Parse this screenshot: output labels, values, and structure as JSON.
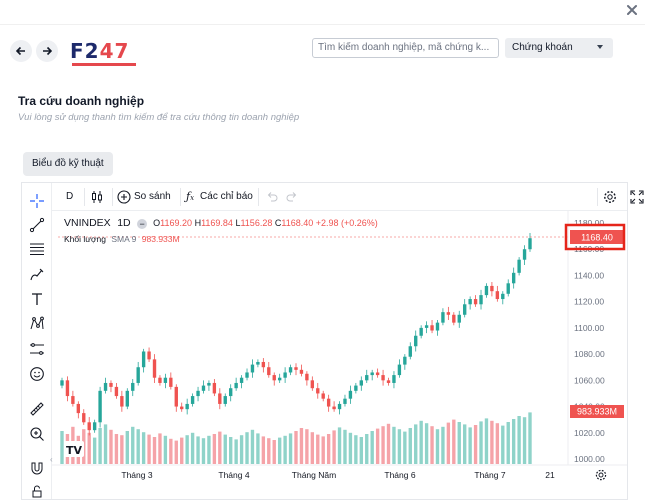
{
  "window": {
    "close_icon": "close-icon"
  },
  "header": {
    "back_icon": "arrow-left-icon",
    "forward_icon": "arrow-right-icon",
    "logo_text_a": "F2",
    "logo_text_b": "47",
    "search_placeholder": "Tìm kiếm doanh nghiệp, mã chứng k...",
    "select_value": "Chứng khoán"
  },
  "page": {
    "title": "Tra cứu doanh nghiệp",
    "subtitle": "Vui lòng sử dụng thanh tìm kiếm để tra cứu thông tin doanh nghiệp",
    "tab_label": "Biểu đồ kỹ thuật"
  },
  "toolbar": {
    "interval": "D",
    "compare_label": "So sánh",
    "indicators_label": "Các chỉ báo"
  },
  "legend": {
    "symbol": "VNINDEX",
    "interval": "1D",
    "o_label": "O",
    "o": "1169.20",
    "h_label": "H",
    "h": "1169.84",
    "l_label": "L",
    "l": "1156.28",
    "c_label": "C",
    "c": "1168.40",
    "change": "+2.98 (+0.26%)",
    "volume_label": "Khối lượng",
    "sma_label": "SMA 9",
    "volume_value": "983.933M"
  },
  "colors": {
    "up": "#26a69a",
    "down": "#ef5350",
    "up_vol": "#8fd3c9",
    "down_vol": "#f5a3a8",
    "highlight_box": "#e5251a"
  },
  "chart_data": {
    "type": "candlestick",
    "price_axis": {
      "ticks": [
        "1180.00",
        "1160.00",
        "1140.00",
        "1120.00",
        "1100.00",
        "1080.00",
        "1060.00",
        "1040.00",
        "1020.00",
        "1000.00"
      ],
      "min": 1000,
      "max": 1180
    },
    "time_axis": {
      "ticks": [
        "Tháng 3",
        "Tháng 4",
        "Tháng Năm",
        "Tháng 6",
        "Tháng 7",
        "21"
      ]
    },
    "last_price_label": "1168.40",
    "last_volume_label": "983.933M",
    "closes": [
      1060,
      1048,
      1042,
      1035,
      1028,
      1022,
      1028,
      1052,
      1058,
      1055,
      1048,
      1040,
      1052,
      1058,
      1070,
      1082,
      1076,
      1062,
      1058,
      1062,
      1055,
      1040,
      1038,
      1042,
      1048,
      1052,
      1056,
      1058,
      1050,
      1042,
      1048,
      1054,
      1058,
      1062,
      1066,
      1072,
      1074,
      1070,
      1064,
      1060,
      1062,
      1066,
      1070,
      1068,
      1065,
      1060,
      1054,
      1050,
      1046,
      1040,
      1038,
      1042,
      1046,
      1052,
      1056,
      1060,
      1064,
      1066,
      1064,
      1060,
      1058,
      1064,
      1072,
      1078,
      1086,
      1094,
      1100,
      1102,
      1098,
      1104,
      1112,
      1110,
      1104,
      1110,
      1118,
      1122,
      1118,
      1125,
      1132,
      1128,
      1122,
      1126,
      1134,
      1142,
      1152,
      1160,
      1168.4
    ],
    "volumes": [
      0.55,
      0.5,
      0.62,
      0.47,
      0.58,
      0.52,
      0.44,
      0.6,
      0.66,
      0.57,
      0.5,
      0.48,
      0.55,
      0.62,
      0.58,
      0.53,
      0.49,
      0.45,
      0.51,
      0.47,
      0.42,
      0.39,
      0.44,
      0.48,
      0.52,
      0.46,
      0.43,
      0.47,
      0.5,
      0.54,
      0.49,
      0.45,
      0.41,
      0.48,
      0.53,
      0.57,
      0.51,
      0.46,
      0.43,
      0.4,
      0.44,
      0.47,
      0.51,
      0.55,
      0.6,
      0.58,
      0.53,
      0.49,
      0.46,
      0.5,
      0.56,
      0.61,
      0.57,
      0.52,
      0.48,
      0.45,
      0.5,
      0.55,
      0.59,
      0.63,
      0.67,
      0.62,
      0.58,
      0.54,
      0.6,
      0.66,
      0.72,
      0.68,
      0.63,
      0.58,
      0.62,
      0.69,
      0.74,
      0.7,
      0.66,
      0.61,
      0.65,
      0.71,
      0.76,
      0.72,
      0.68,
      0.64,
      0.7,
      0.75,
      0.8,
      0.78,
      0.86
    ]
  }
}
